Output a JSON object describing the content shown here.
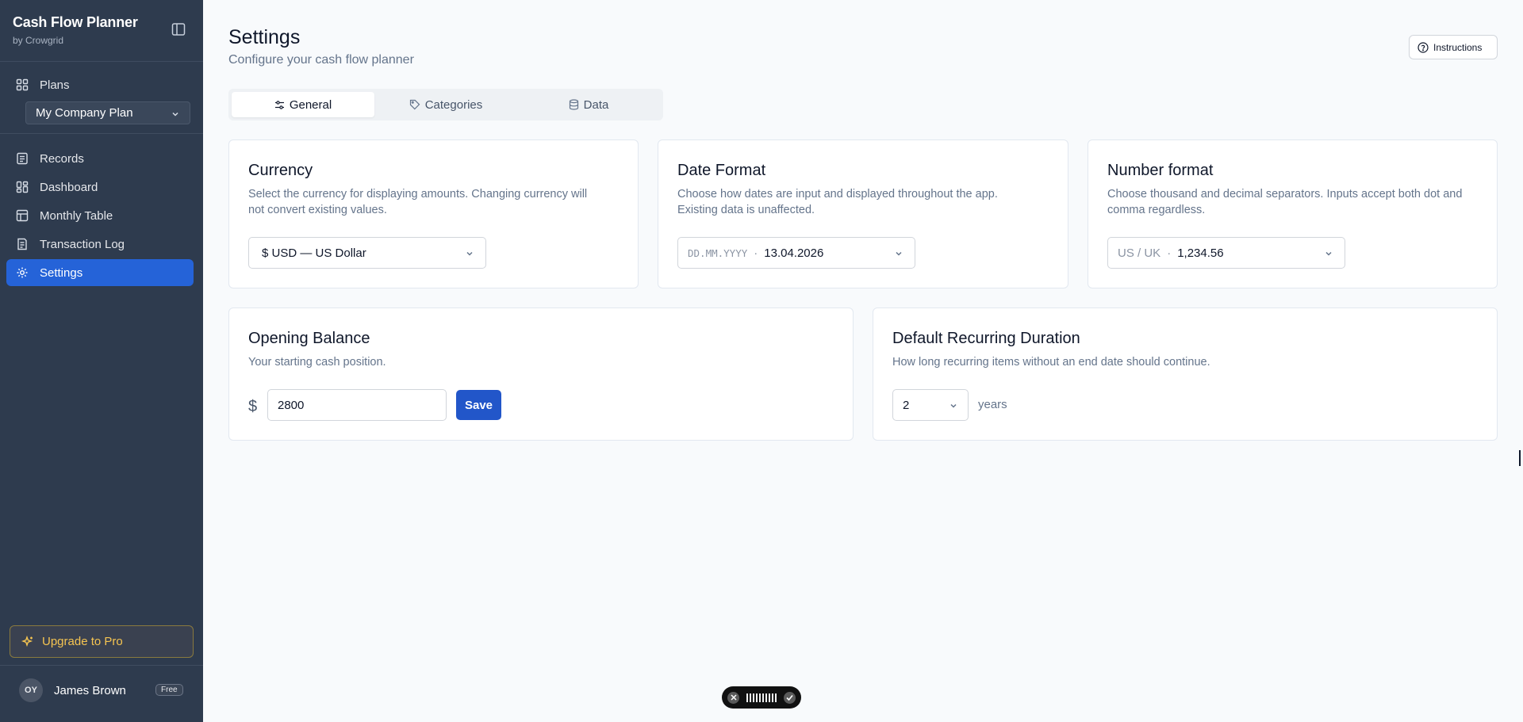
{
  "app": {
    "title": "Cash Flow Planner",
    "subtitle": "by Crowgrid"
  },
  "sidebar": {
    "plans_label": "Plans",
    "plan_select": "My Company Plan",
    "items": [
      {
        "label": "Records",
        "icon": "records-icon"
      },
      {
        "label": "Dashboard",
        "icon": "dashboard-icon"
      },
      {
        "label": "Monthly Table",
        "icon": "table-icon"
      },
      {
        "label": "Transaction Log",
        "icon": "log-icon"
      },
      {
        "label": "Settings",
        "icon": "gear-icon",
        "active": true
      }
    ],
    "upgrade_label": "Upgrade to Pro",
    "user": {
      "initials": "OY",
      "name": "James Brown",
      "badge": "Free"
    }
  },
  "header": {
    "title": "Settings",
    "subtitle": "Configure your cash flow planner",
    "instructions_label": "Instructions"
  },
  "tabs": [
    {
      "label": "General",
      "active": true
    },
    {
      "label": "Categories"
    },
    {
      "label": "Data"
    }
  ],
  "cards": {
    "currency": {
      "title": "Currency",
      "desc_line1": "Select the currency for displaying amounts. Changing currency will",
      "desc_line2": "not convert existing values.",
      "value": "$ USD — US Dollar"
    },
    "date_format": {
      "title": "Date Format",
      "desc_line1": "Choose how dates are input and displayed throughout the app.",
      "desc_line2": "Existing data is unaffected.",
      "pattern": "DD.MM.YYYY",
      "sep": "·",
      "example": "13.04.2026"
    },
    "number_format": {
      "title": "Number format",
      "desc_line1": "Choose thousand and decimal separators. Inputs accept both dot and",
      "desc_line2": "comma regardless.",
      "locale": "US / UK",
      "sep": "·",
      "example": "1,234.56"
    },
    "opening_balance": {
      "title": "Opening Balance",
      "desc": "Your starting cash position.",
      "currency_symbol": "$",
      "value": "2800",
      "save_label": "Save"
    },
    "recurring": {
      "title": "Default Recurring Duration",
      "desc": "How long recurring items without an end date should continue.",
      "value": "2",
      "unit": "years"
    }
  },
  "colors": {
    "sidebar_bg": "#2e3b4e",
    "accent": "#2563d8",
    "upgrade": "#f5c451"
  }
}
